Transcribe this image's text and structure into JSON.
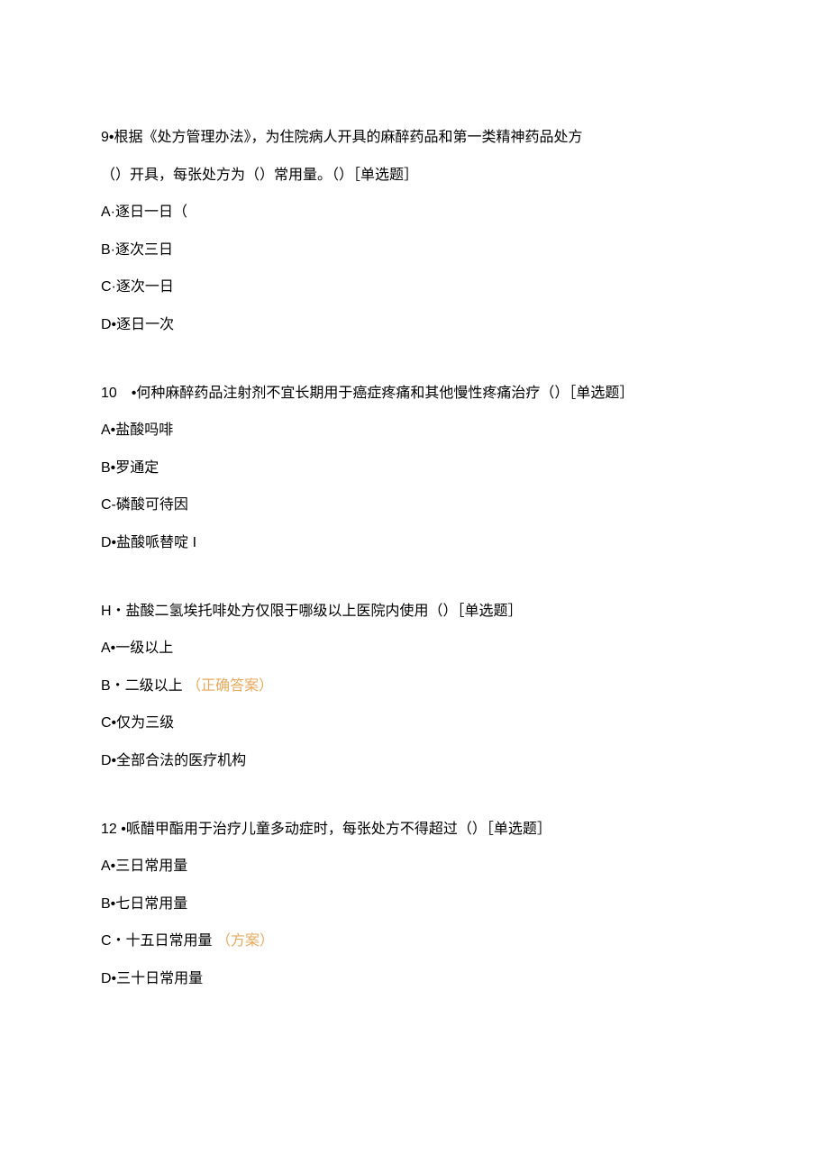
{
  "questions": [
    {
      "number": "9",
      "text_line1": "9•根据《处方管理办法》，为住院病人开具的麻醉药品和第一类精神药品处方",
      "text_line2": "（）开具，每张处方为（）常用量。（）［单选题］",
      "options": [
        {
          "label": "A·逐日一日（",
          "answer": ""
        },
        {
          "label": "B·逐次三日",
          "answer": ""
        },
        {
          "label": "C·逐次一日",
          "answer": ""
        },
        {
          "label": "D•逐日一次",
          "answer": ""
        }
      ]
    },
    {
      "number": "10",
      "text_line1": "10　•何种麻醉药品注射剂不宜长期用于癌症疼痛和其他慢性疼痛治疗（）［单选题］",
      "text_line2": "",
      "options": [
        {
          "label": "A•盐酸吗啡",
          "answer": ""
        },
        {
          "label": "B•罗通定",
          "answer": ""
        },
        {
          "label": "C-磷酸可待因",
          "answer": ""
        },
        {
          "label": "D•盐酸哌替啶 I",
          "answer": ""
        }
      ]
    },
    {
      "number": "H",
      "text_line1": "H・盐酸二氢埃托啡处方仅限于哪级以上医院内使用（）［单选题］",
      "text_line2": "",
      "options": [
        {
          "label": "A•一级以上",
          "answer": ""
        },
        {
          "label": "B・二级以上",
          "answer": "（正确答案）"
        },
        {
          "label": "C•仅为三级",
          "answer": ""
        },
        {
          "label": "D•全部合法的医疗机构",
          "answer": ""
        }
      ]
    },
    {
      "number": "12",
      "text_line1": "12  •哌醋甲酯用于治疗儿童多动症时，每张处方不得超过（）［单选题］",
      "text_line2": "",
      "options": [
        {
          "label": "A•三日常用量",
          "answer": ""
        },
        {
          "label": "B•七日常用量",
          "answer": ""
        },
        {
          "label": "C・十五日常用量",
          "answer": "（方案）"
        },
        {
          "label": "D•三十日常用量",
          "answer": ""
        }
      ]
    }
  ]
}
